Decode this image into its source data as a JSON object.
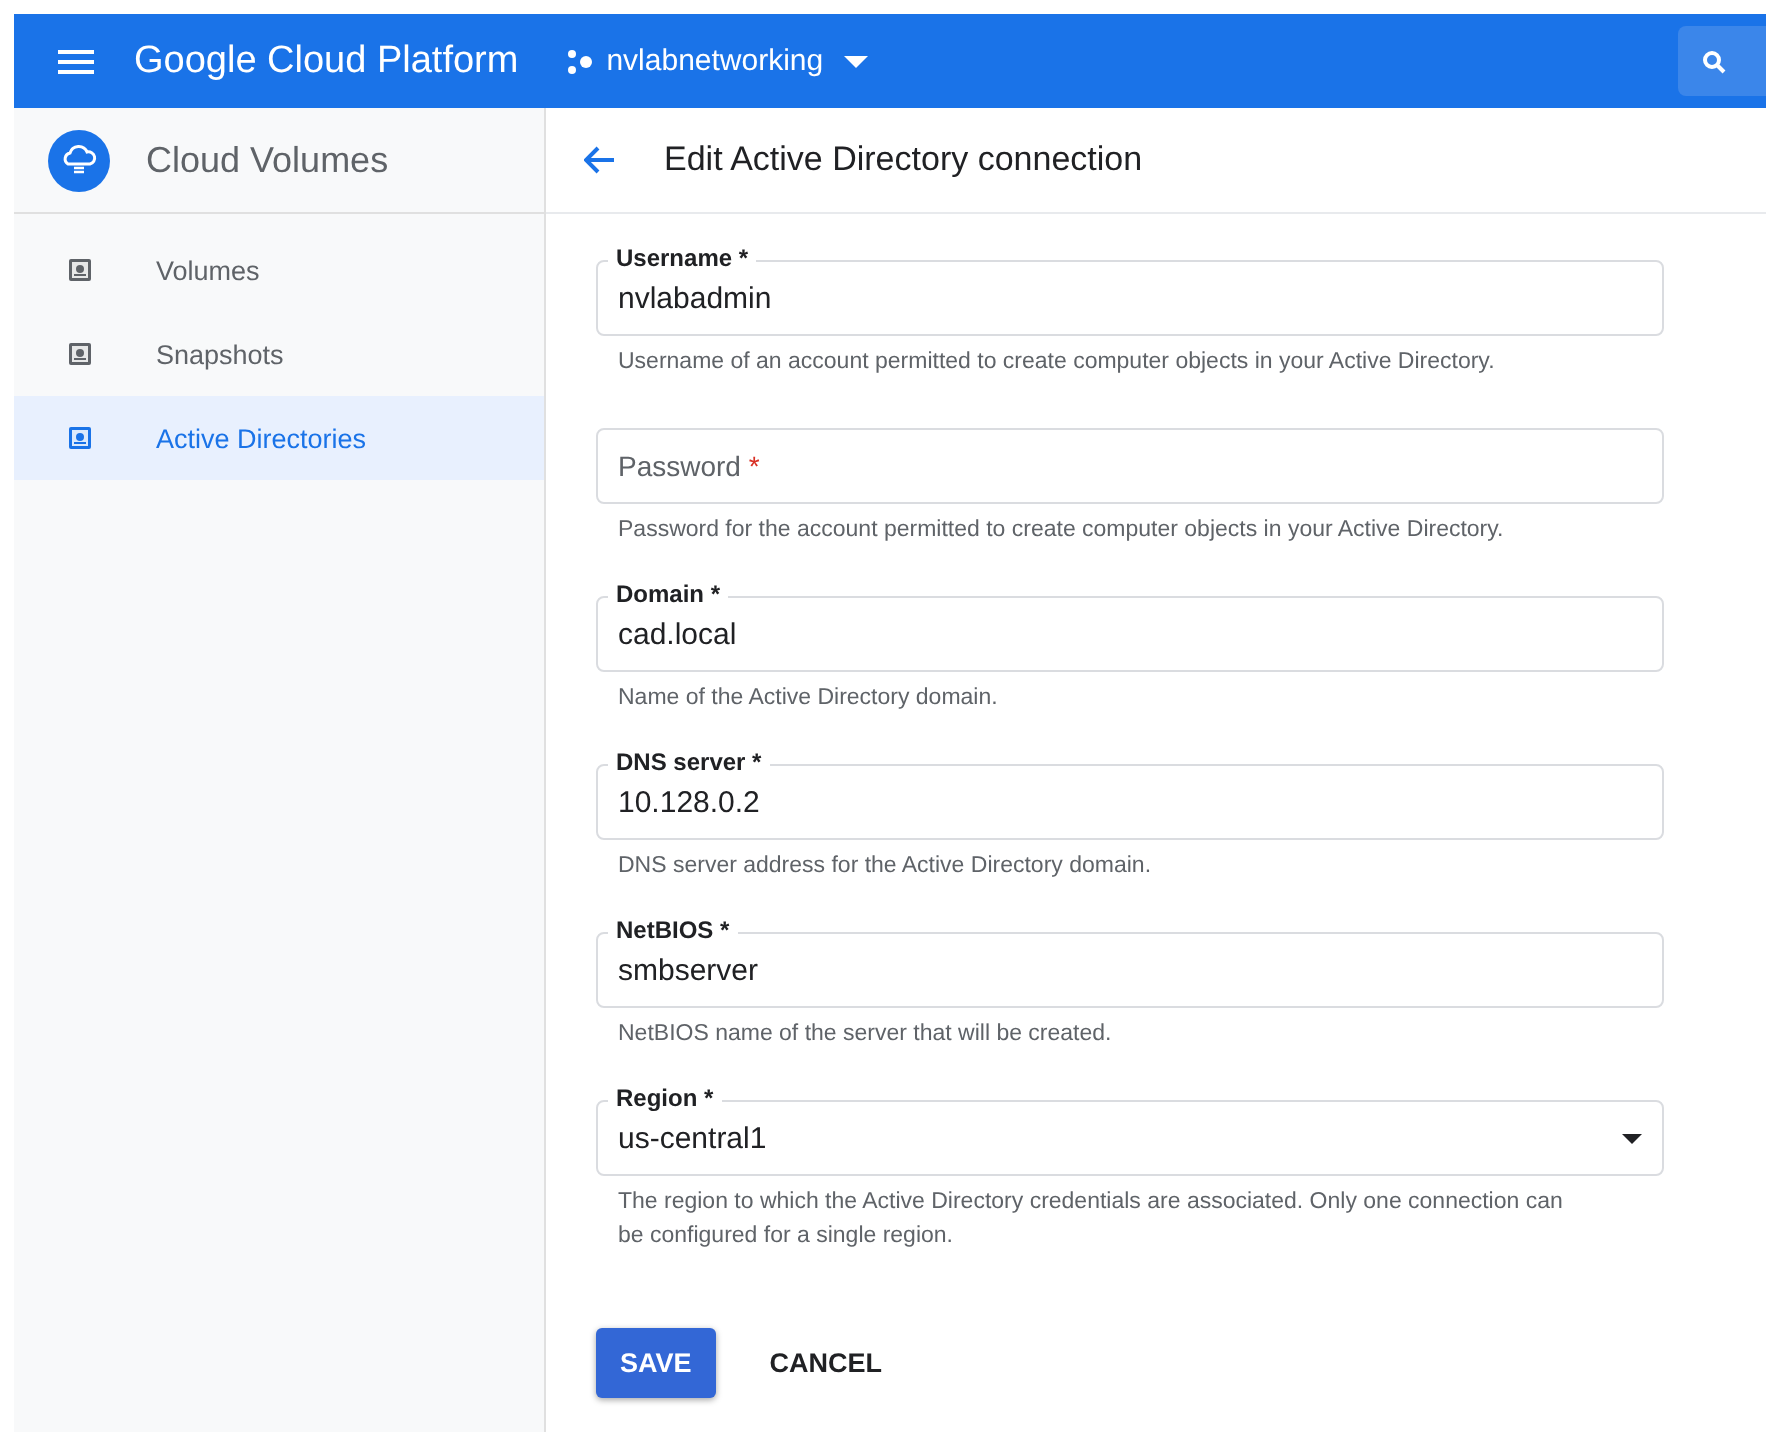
{
  "topbar": {
    "title": "Google Cloud Platform",
    "project": "nvlabnetworking"
  },
  "sidebar": {
    "title": "Cloud Volumes",
    "items": [
      {
        "label": "Volumes",
        "selected": false
      },
      {
        "label": "Snapshots",
        "selected": false
      },
      {
        "label": "Active Directories",
        "selected": true
      }
    ]
  },
  "page": {
    "title": "Edit Active Directory connection"
  },
  "fields": [
    {
      "kind": "text",
      "label": "Username",
      "mark": "*",
      "value": "nvlabadmin",
      "help": "Username of an account permitted to create computer objects in your Active Directory."
    },
    {
      "kind": "text",
      "label": "Password",
      "mark": "*",
      "help": "Password for the account permitted to create computer objects in your Active Directory."
    },
    {
      "kind": "text",
      "label": "Domain",
      "mark": "*",
      "value": "cad.local",
      "help": "Name of the Active Directory domain."
    },
    {
      "kind": "text",
      "label": "DNS server",
      "mark": "*",
      "value": "10.128.0.2",
      "help": "DNS server address for the Active Directory domain."
    },
    {
      "kind": "text",
      "label": "NetBIOS",
      "mark": "*",
      "value": "smbserver",
      "help": "NetBIOS name of the server that will be created."
    },
    {
      "kind": "select",
      "label": "Region",
      "mark": "*",
      "value": "us-central1",
      "help": "The region to which the Active Directory credentials are associated. Only one connection can be configured for a single region."
    }
  ],
  "buttons": [
    {
      "label": "SAVE",
      "kind": "primary"
    },
    {
      "label": "CANCEL",
      "kind": "text"
    }
  ]
}
